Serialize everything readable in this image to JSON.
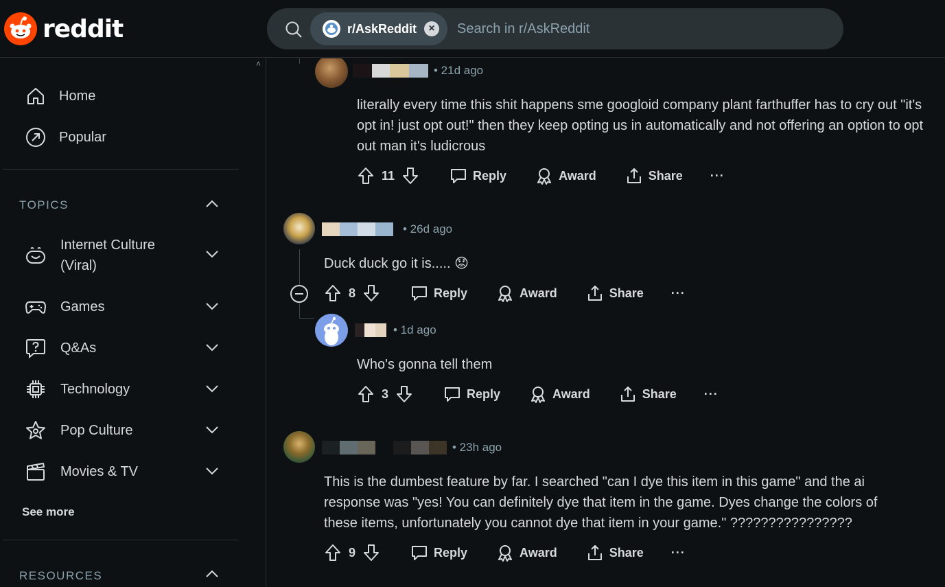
{
  "brand": {
    "name": "reddit"
  },
  "search": {
    "chip_label": "r/AskReddit",
    "placeholder": "Search in r/AskReddit"
  },
  "sidebar": {
    "nav": [
      {
        "label": "Home",
        "icon": "home-icon"
      },
      {
        "label": "Popular",
        "icon": "popular-arrow-icon"
      }
    ],
    "topics_heading": "TOPICS",
    "topics": [
      {
        "label": "Internet Culture (Viral)",
        "icon": "smile-face-icon"
      },
      {
        "label": "Games",
        "icon": "gamepad-icon"
      },
      {
        "label": "Q&As",
        "icon": "question-bubble-icon"
      },
      {
        "label": "Technology",
        "icon": "chip-icon"
      },
      {
        "label": "Pop Culture",
        "icon": "star-icon"
      },
      {
        "label": "Movies & TV",
        "icon": "clapperboard-icon"
      }
    ],
    "see_more": "See more",
    "resources_heading": "RESOURCES"
  },
  "actions": {
    "reply": "Reply",
    "award": "Award",
    "share": "Share",
    "more": "···"
  },
  "comments": [
    {
      "age": "• 21d ago",
      "text": "literally every time this shit happens sme googloid company plant farthuffer has to cry out \"it's opt in! just opt out!\" then they keep opting us in automatically and not offering an option to opt out man it's ludicrous",
      "votes": "11"
    },
    {
      "age": "• 26d ago",
      "text": "Duck duck go it is.....",
      "emoji": "😟",
      "votes": "8"
    },
    {
      "age": "• 1d ago",
      "text": "Who's gonna tell them",
      "votes": "3"
    },
    {
      "age": "• 23h ago",
      "text": "This is the dumbest feature by far. I searched \"can I dye this item in this game\" and the ai response was \"yes! You can definitely dye that item in the game. Dyes change the colors of these items, unfortunately you cannot dye that item in your game.\" ????????????????",
      "votes": "9"
    }
  ],
  "colors": {
    "background": "#0e1113",
    "search_bg": "#2a3236",
    "brand_orange": "#ff4500",
    "muted_text": "#8ba2ad"
  }
}
